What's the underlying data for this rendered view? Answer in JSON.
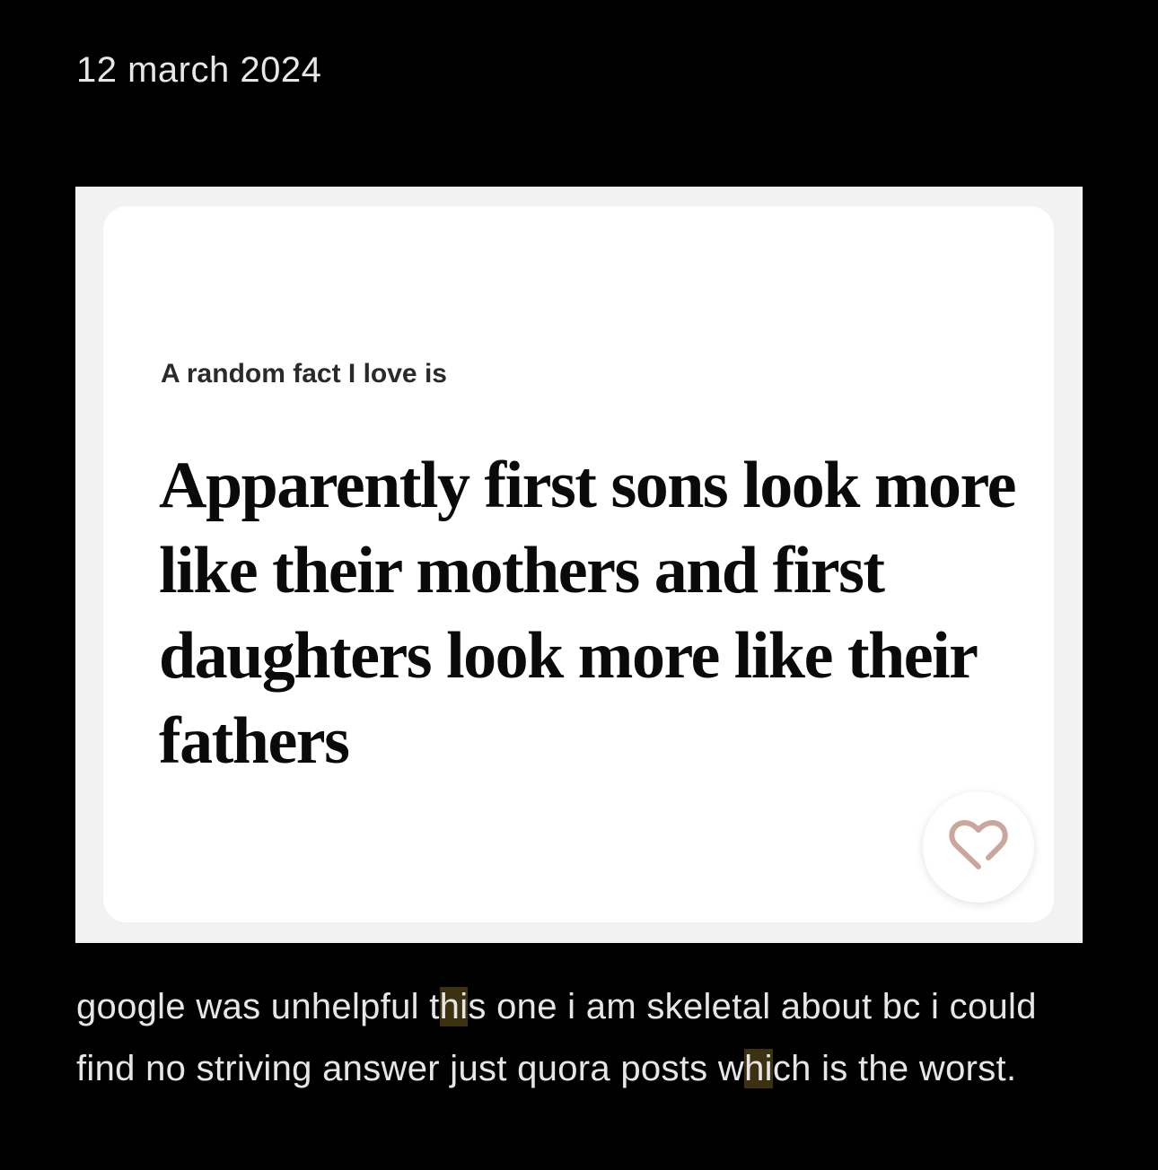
{
  "post": {
    "date": "12 march 2024"
  },
  "prompt_card": {
    "prompt_label": "A random fact I love is",
    "answer": "Apparently first sons look more like their mothers and first daughters look more like their fathers",
    "like_icon": "heart-icon",
    "like_icon_color": "#c9a79c"
  },
  "caption": {
    "part1": "google was unhelpful t",
    "hl1": "hi",
    "part2": "s one i am skeletal about bc i could find no striving answer just quora posts w",
    "hl2": "hi",
    "part3": "ch is the worst."
  },
  "colors": {
    "background": "#000000",
    "card_frame": "#f2f2f2",
    "card": "#ffffff",
    "highlight": "#3d3210"
  }
}
